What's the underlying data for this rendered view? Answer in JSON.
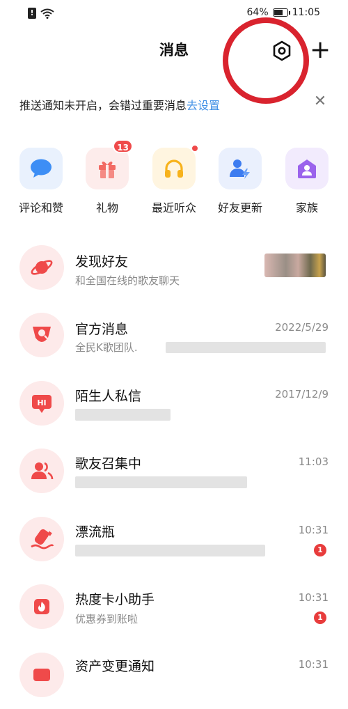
{
  "status_bar": {
    "battery": "64%",
    "time": "11:05",
    "battery_level": 0.64
  },
  "header": {
    "title": "消息"
  },
  "notice": {
    "text": "推送通知未开启，会错过重要消息",
    "link": "去设置"
  },
  "shortcuts": [
    {
      "label": "评论和赞",
      "icon": "chat-bubble-icon",
      "badge": ""
    },
    {
      "label": "礼物",
      "icon": "gift-icon",
      "badge": "13"
    },
    {
      "label": "最近听众",
      "icon": "headphones-icon",
      "badge": "dot"
    },
    {
      "label": "好友更新",
      "icon": "friend-update-icon",
      "badge": ""
    },
    {
      "label": "家族",
      "icon": "family-house-icon",
      "badge": ""
    }
  ],
  "messages": [
    {
      "title": "发现好友",
      "subtitle": "和全国在线的歌友聊天",
      "time": "",
      "unread": "",
      "icon": "planet-icon"
    },
    {
      "title": "官方消息",
      "subtitle": "全民K歌团队.",
      "time": "2022/5/29",
      "unread": "",
      "icon": "official-k-icon"
    },
    {
      "title": "陌生人私信",
      "subtitle": "",
      "time": "2017/12/9",
      "unread": "",
      "icon": "hi-bubble-icon"
    },
    {
      "title": "歌友召集中",
      "subtitle": "",
      "time": "11:03",
      "unread": "",
      "icon": "group-people-icon"
    },
    {
      "title": "漂流瓶",
      "subtitle": "",
      "time": "10:31",
      "unread": "1",
      "icon": "drift-bottle-icon"
    },
    {
      "title": "热度卡小助手",
      "subtitle": "优惠券到账啦",
      "time": "10:31",
      "unread": "1",
      "icon": "heat-card-icon"
    },
    {
      "title": "资产变更通知",
      "subtitle": "",
      "time": "10:31",
      "unread": "",
      "icon": "asset-change-icon"
    }
  ],
  "colors": {
    "accent_red": "#e83c3c",
    "link_blue": "#3f8fe6",
    "annotation_ring": "#d9232e"
  }
}
